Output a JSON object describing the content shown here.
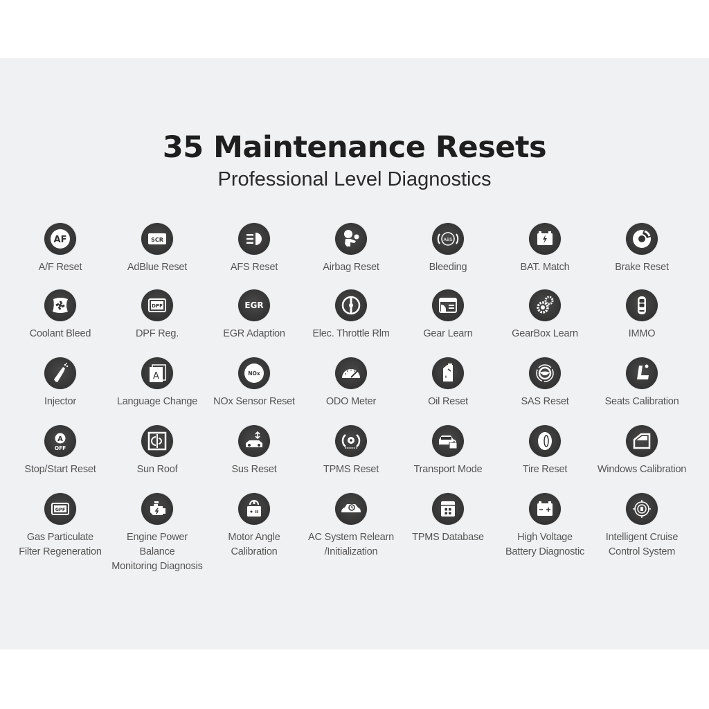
{
  "header": {
    "title": "35 Maintenance Resets",
    "subtitle": "Professional Level Diagnostics"
  },
  "colors": {
    "panel_background": "#f0f1f2",
    "icon_circle": "#333333",
    "icon_glyph": "#ffffff",
    "label_text": "#555555",
    "title_text": "#1e1e1e"
  },
  "functions": [
    {
      "label": "A/F Reset",
      "icon": "af-icon",
      "glyph": "AF"
    },
    {
      "label": "AdBlue Reset",
      "icon": "scr-icon",
      "glyph": "SCR"
    },
    {
      "label": "AFS Reset",
      "icon": "headlight-icon"
    },
    {
      "label": "Airbag Reset",
      "icon": "airbag-icon"
    },
    {
      "label": "Bleeding",
      "icon": "abs-icon",
      "glyph": "ABS"
    },
    {
      "label": "BAT. Match",
      "icon": "battery-icon"
    },
    {
      "label": "Brake Reset",
      "icon": "brake-disc-icon"
    },
    {
      "label": "Coolant Bleed",
      "icon": "coolant-fan-icon"
    },
    {
      "label": "DPF Reg.",
      "icon": "dpf-icon",
      "glyph": "DPF"
    },
    {
      "label": "EGR Adaption",
      "icon": "egr-icon",
      "glyph": "EGR"
    },
    {
      "label": "Elec. Throttle Rlm",
      "icon": "throttle-icon"
    },
    {
      "label": "Gear Learn",
      "icon": "gear-learn-icon"
    },
    {
      "label": "GearBox Learn",
      "icon": "gears-icon"
    },
    {
      "label": "IMMO",
      "icon": "car-key-icon"
    },
    {
      "label": "Injector",
      "icon": "injector-icon"
    },
    {
      "label": "Language Change",
      "icon": "language-icon",
      "glyph": "A"
    },
    {
      "label": "NOx Sensor Reset",
      "icon": "nox-icon",
      "glyph": "NOx"
    },
    {
      "label": "ODO Meter",
      "icon": "odometer-icon"
    },
    {
      "label": "Oil Reset",
      "icon": "oil-can-icon"
    },
    {
      "label": "SAS Reset",
      "icon": "steering-wheel-icon"
    },
    {
      "label": "Seats Calibration",
      "icon": "seat-icon"
    },
    {
      "label": "Stop/Start Reset",
      "icon": "stop-start-icon",
      "glyph": "A",
      "glyph2": "OFF"
    },
    {
      "label": "Sun Roof",
      "icon": "sunroof-icon"
    },
    {
      "label": "Sus Reset",
      "icon": "suspension-icon"
    },
    {
      "label": "TPMS Reset",
      "icon": "tpms-icon"
    },
    {
      "label": "Transport Mode",
      "icon": "transport-lock-icon"
    },
    {
      "label": "Tire Reset",
      "icon": "tire-icon"
    },
    {
      "label": "Windows Calibration",
      "icon": "window-icon"
    },
    {
      "label": "Gas Particulate\nFilter Regeneration",
      "icon": "gpf-icon",
      "glyph": "GPF"
    },
    {
      "label": "Engine Power Balance\nMonitoring Diagnosis",
      "icon": "engine-icon"
    },
    {
      "label": "Motor Angle\nCalibration",
      "icon": "motor-icon"
    },
    {
      "label": "AC System Relearn\n/Initialization",
      "icon": "ac-car-icon"
    },
    {
      "label": "TPMS Database",
      "icon": "database-icon"
    },
    {
      "label": "High Voltage\nBattery Diagnostic",
      "icon": "hv-battery-icon"
    },
    {
      "label": "Intelligent Cruise\nControl System",
      "icon": "cruise-radar-icon"
    }
  ]
}
